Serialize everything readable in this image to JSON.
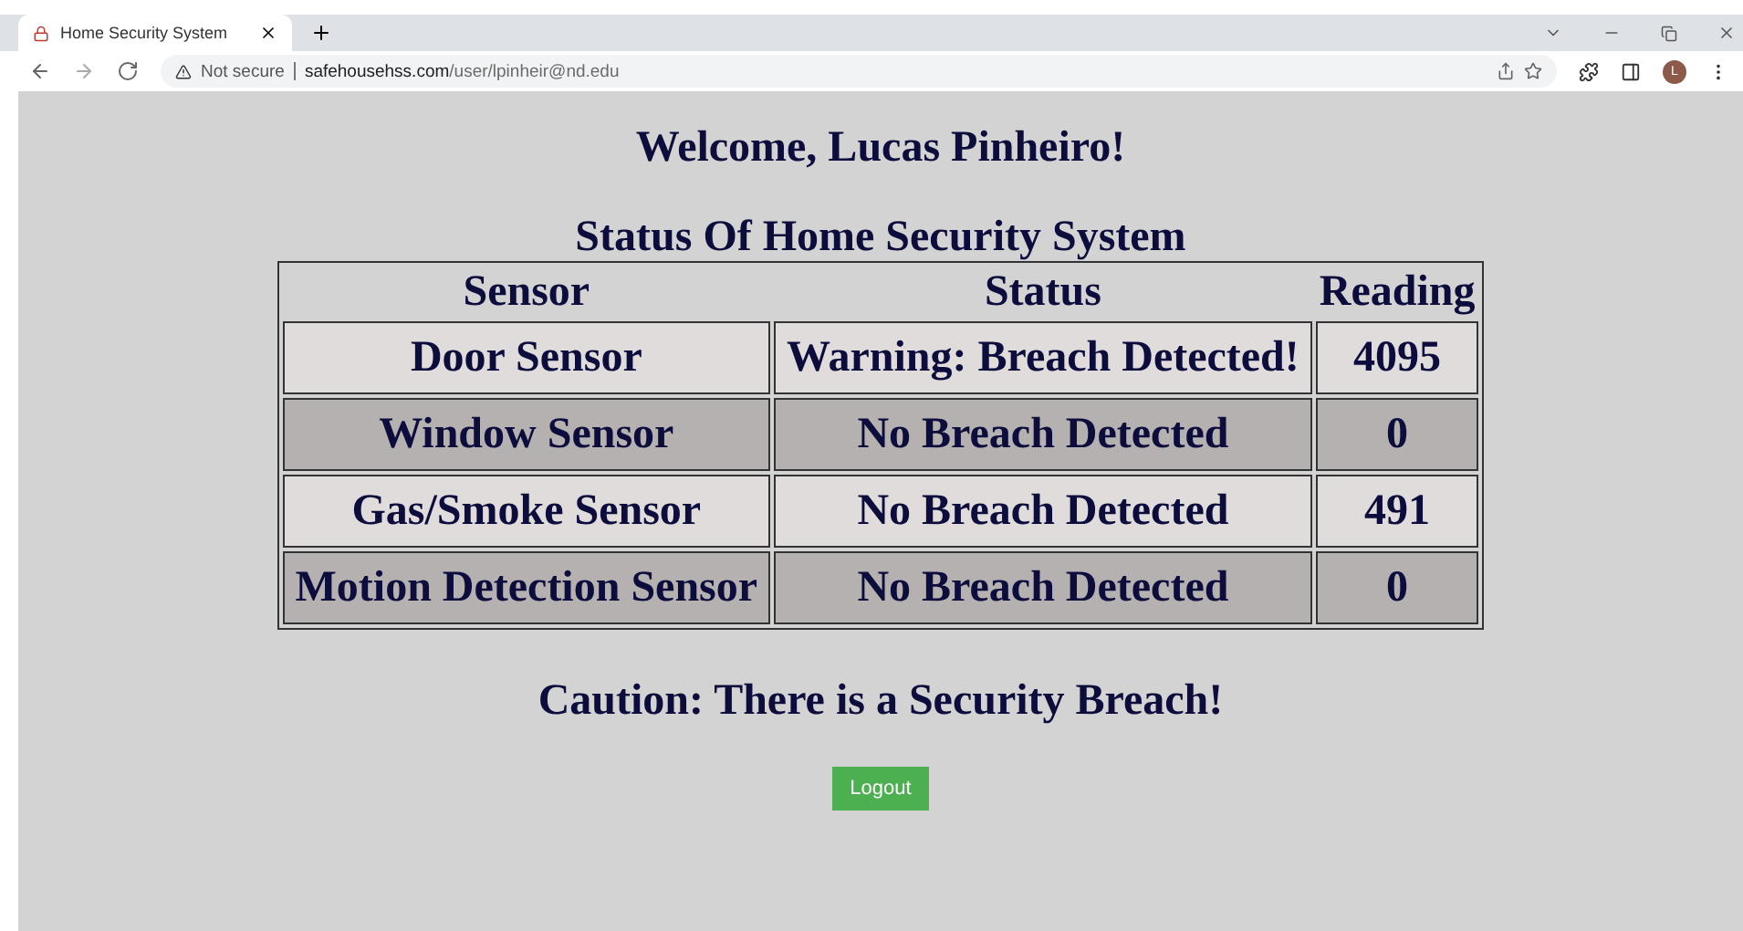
{
  "browser": {
    "tab": {
      "title": "Home Security System",
      "selected": true
    },
    "security_label": "Not secure",
    "url_host": "safehousehss.com",
    "url_path": "/user/lpinheir@nd.edu",
    "avatar": "L"
  },
  "page": {
    "welcome": "Welcome, Lucas Pinheiro!",
    "table_title": "Status Of Home Security System",
    "table": {
      "columns": [
        "Sensor",
        "Status",
        "Reading"
      ],
      "rows": [
        {
          "sensor": "Door Sensor",
          "status": "Warning: Breach Detected!",
          "reading": "4095"
        },
        {
          "sensor": "Window Sensor",
          "status": "No Breach Detected",
          "reading": "0"
        },
        {
          "sensor": "Gas/Smoke Sensor",
          "status": "No Breach Detected",
          "reading": "491"
        },
        {
          "sensor": "Motion Detection Sensor",
          "status": "No Breach Detected",
          "reading": "0"
        }
      ]
    },
    "caution": "Caution: There is a Security Breach!",
    "logout": "Logout"
  }
}
